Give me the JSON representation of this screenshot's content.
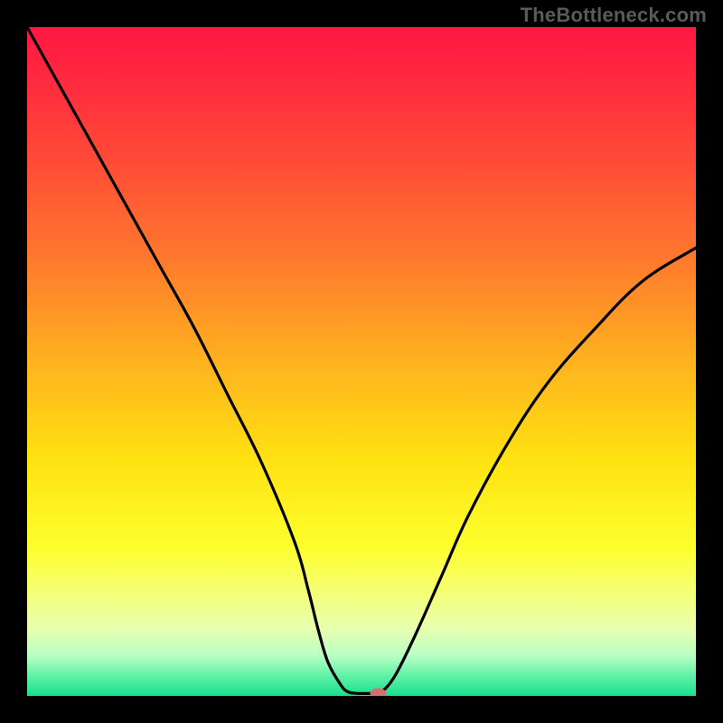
{
  "watermark": "TheBottleneck.com",
  "chart_data": {
    "type": "line",
    "title": "",
    "xlabel": "",
    "ylabel": "",
    "xlim": [
      0,
      100
    ],
    "ylim": [
      0,
      100
    ],
    "gradient": {
      "stops": [
        {
          "offset": 0.0,
          "color": "#ff1744"
        },
        {
          "offset": 0.08,
          "color": "#ff2a3f"
        },
        {
          "offset": 0.2,
          "color": "#ff4b36"
        },
        {
          "offset": 0.35,
          "color": "#ff7a2d"
        },
        {
          "offset": 0.5,
          "color": "#ffb21f"
        },
        {
          "offset": 0.65,
          "color": "#ffe311"
        },
        {
          "offset": 0.78,
          "color": "#fdff2e"
        },
        {
          "offset": 0.84,
          "color": "#f6ff70"
        },
        {
          "offset": 0.9,
          "color": "#e7ffb0"
        },
        {
          "offset": 0.94,
          "color": "#b8ffc4"
        },
        {
          "offset": 0.97,
          "color": "#60f2a6"
        },
        {
          "offset": 1.0,
          "color": "#18e08e"
        }
      ]
    },
    "series": [
      {
        "name": "curve-left",
        "x": [
          0,
          5,
          10,
          15,
          20,
          25,
          30,
          35,
          40,
          42,
          43.5,
          45,
          47,
          48,
          49
        ],
        "y": [
          100,
          91,
          82,
          73,
          64,
          55,
          45,
          35,
          23,
          16,
          10,
          5,
          1.5,
          0.6,
          0.4
        ]
      },
      {
        "name": "flat-bottom",
        "x": [
          49,
          50,
          51,
          52,
          53
        ],
        "y": [
          0.4,
          0.35,
          0.35,
          0.4,
          0.6
        ]
      },
      {
        "name": "curve-right",
        "x": [
          53,
          55,
          58,
          62,
          66,
          72,
          78,
          85,
          92,
          100
        ],
        "y": [
          0.6,
          3,
          9,
          18,
          27,
          38,
          47,
          55,
          62,
          67
        ]
      }
    ],
    "marker": {
      "x": 52.5,
      "y": 0.35,
      "color": "#d4706e"
    }
  }
}
